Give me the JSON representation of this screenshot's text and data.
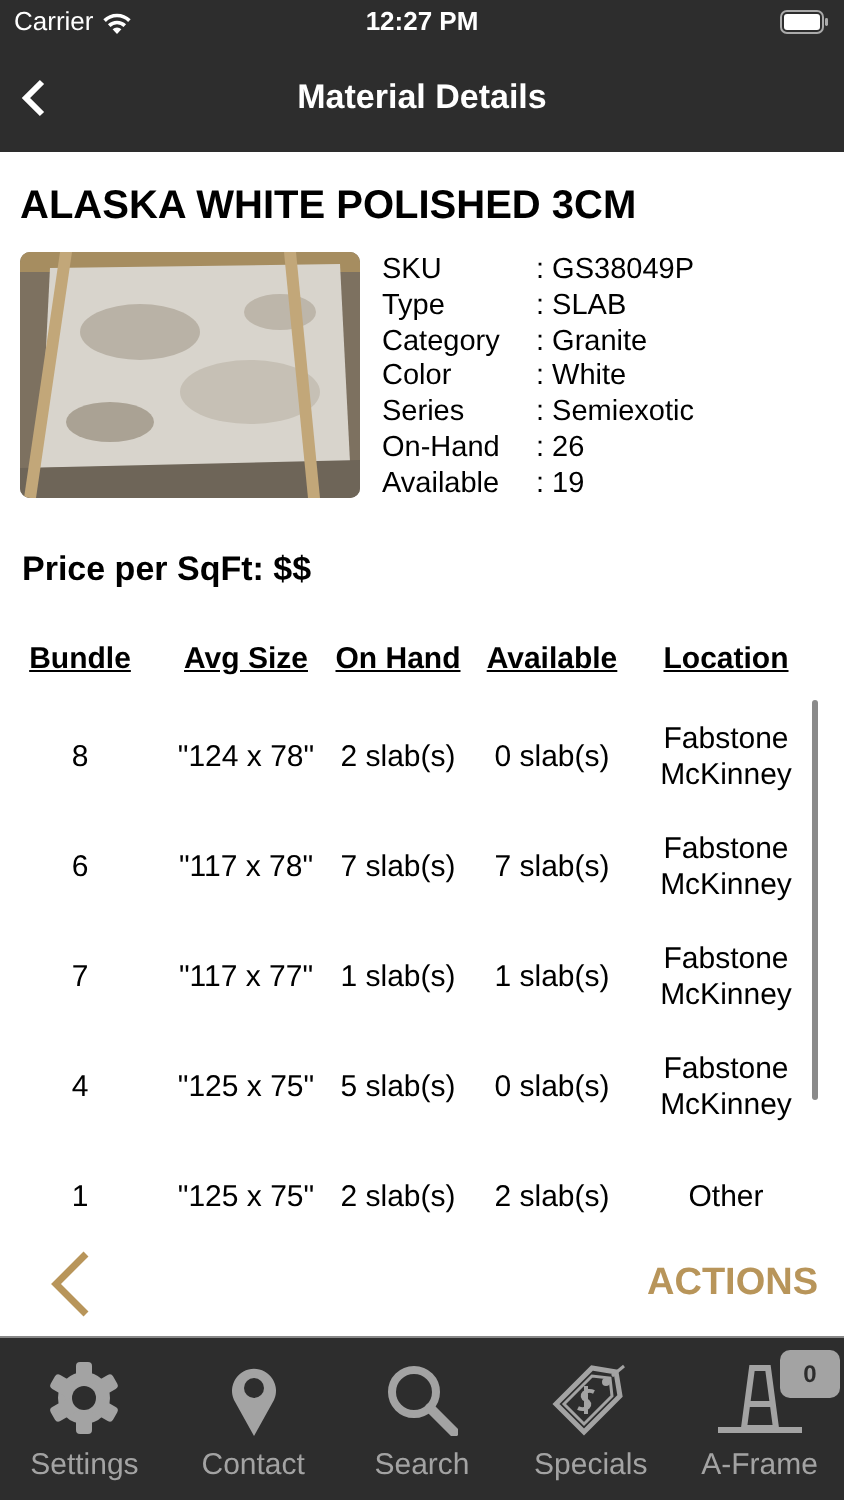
{
  "status_bar": {
    "carrier": "Carrier",
    "time": "12:27 PM"
  },
  "nav_bar": {
    "title": "Material Details"
  },
  "material": {
    "name": "ALASKA WHITE POLISHED 3CM",
    "details": [
      {
        "label": "SKU",
        "value": ": GS38049P"
      },
      {
        "label": "Type",
        "value": ": SLAB"
      },
      {
        "label": "Category",
        "value": ": Granite"
      },
      {
        "label": "Color",
        "value": ": White"
      },
      {
        "label": "Series",
        "value": ": Semiexotic"
      },
      {
        "label": "On-Hand",
        "value": ": 26"
      },
      {
        "label": "Available",
        "value": ": 19"
      }
    ],
    "price": "Price per SqFt: $$"
  },
  "table": {
    "columns": [
      "Bundle",
      "Avg Size",
      "On Hand",
      "Available",
      "Location"
    ],
    "rows": [
      {
        "bundle": "8",
        "avg_size": "\"124 x 78\"",
        "on_hand": "2 slab(s)",
        "available": "0 slab(s)",
        "location": [
          "Fabstone",
          "McKinney"
        ]
      },
      {
        "bundle": "6",
        "avg_size": "\"117 x 78\"",
        "on_hand": "7 slab(s)",
        "available": "7 slab(s)",
        "location": [
          "Fabstone",
          "McKinney"
        ]
      },
      {
        "bundle": "7",
        "avg_size": "\"117 x 77\"",
        "on_hand": "1 slab(s)",
        "available": "1 slab(s)",
        "location": [
          "Fabstone",
          "McKinney"
        ]
      },
      {
        "bundle": "4",
        "avg_size": "\"125 x 75\"",
        "on_hand": "5 slab(s)",
        "available": "0 slab(s)",
        "location": [
          "Fabstone",
          "McKinney"
        ]
      },
      {
        "bundle": "1",
        "avg_size": "\"125 x 75\"",
        "on_hand": "2 slab(s)",
        "available": "2 slab(s)",
        "location": [
          "Other"
        ]
      }
    ]
  },
  "action_bar": {
    "actions_label": "ACTIONS"
  },
  "tab_bar": [
    {
      "kind": "settings",
      "label": "Settings"
    },
    {
      "kind": "contact",
      "label": "Contact"
    },
    {
      "kind": "search",
      "label": "Search"
    },
    {
      "kind": "specials",
      "label": "Specials"
    },
    {
      "kind": "aframe",
      "label": "A-Frame",
      "badge": "0"
    }
  ]
}
